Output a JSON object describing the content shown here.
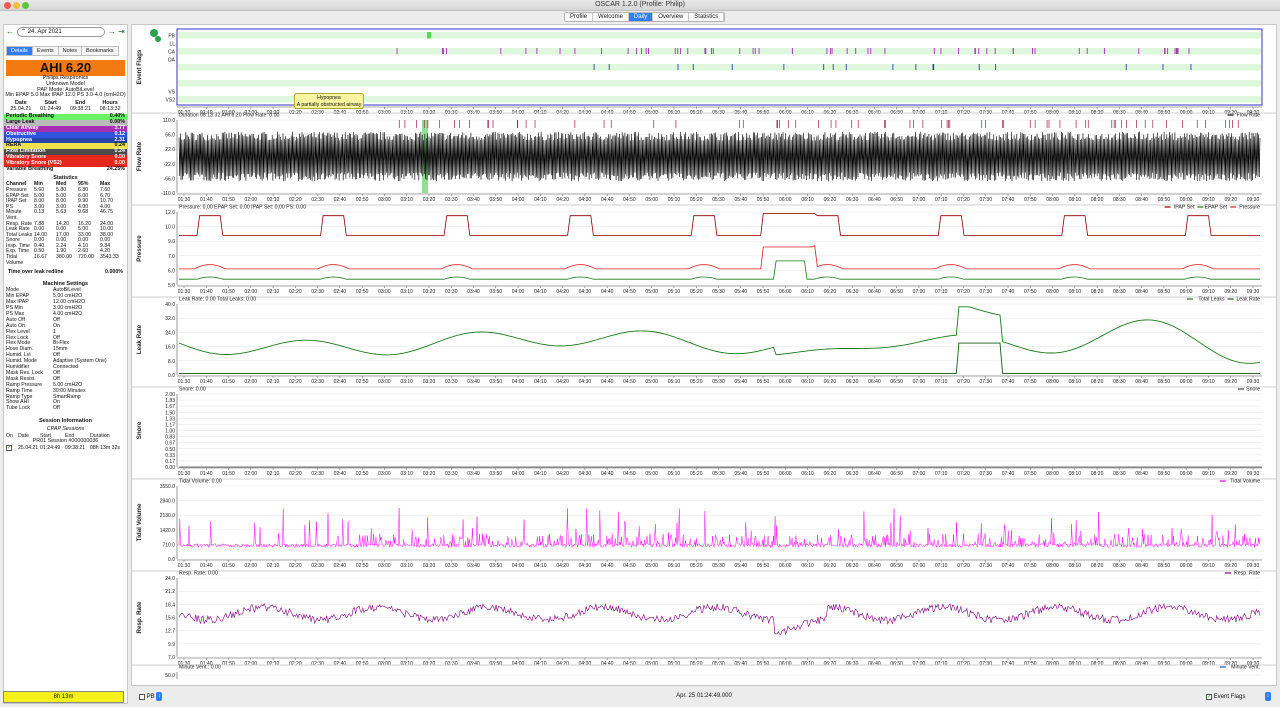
{
  "window": {
    "title": "OSCAR 1.2.0 (Profile: Philip)"
  },
  "tabs": [
    "Profile",
    "Welcome",
    "Daily",
    "Overview",
    "Statistics"
  ],
  "active_tab": "Daily",
  "date": {
    "value": "24. Apr 2021"
  },
  "left_tabs": [
    "Details",
    "Events",
    "Notes",
    "Bookmarks"
  ],
  "summary": {
    "ahi": "AHI 6.20",
    "manufacturer": "Philips Respironics",
    "model": "Unknown Model",
    "mode": "PAP Mode: AutoBiLevel",
    "settings": "Min EPAP 5.0 Max IPAP 12.0 PS 3.0-4.0 (cmH2O)",
    "session_headers": [
      "Date",
      "Start",
      "End",
      "Hours"
    ],
    "session_values": [
      "25.04.21",
      "01:24:49",
      "09:38:21",
      "08:13:32"
    ]
  },
  "events": [
    {
      "label": "Periodic Breathing",
      "value": "0.40%",
      "color": "#6cf266"
    },
    {
      "label": "Large Leak",
      "value": "0.00%",
      "color": "#bbbbbb"
    },
    {
      "label": "Clear Airway",
      "value": "3.77",
      "color": "#a62fb4"
    },
    {
      "label": "Obstructive",
      "value": "0.12",
      "color": "#2f55dc"
    },
    {
      "label": "Hypopnea",
      "value": "2.31",
      "color": "#2545a8"
    },
    {
      "label": "RERA",
      "value": "0.24",
      "color": "#ece44a"
    },
    {
      "label": "Flow Limitation",
      "value": "0.24",
      "color": "#4b4b4b"
    },
    {
      "label": "Vibratory Snore",
      "value": "0.00",
      "color": "#e6271e"
    },
    {
      "label": "Vibratory Snore (VS2)",
      "value": "0.00",
      "color": "#e6271e"
    },
    {
      "label": "Variable Breathing",
      "value": "24.25%",
      "color": "#ffffff"
    }
  ],
  "statistics": {
    "title": "Statistics",
    "headers": [
      "Channel",
      "Min",
      "Med",
      "95%",
      "Max"
    ],
    "rows": [
      [
        "Pressure",
        "5.60",
        "5.80",
        "6.80",
        "7.60"
      ],
      [
        "EPAP Set",
        "5.00",
        "5.00",
        "6.00",
        "6.70"
      ],
      [
        "IPAP Set",
        "8.00",
        "8.00",
        "9.90",
        "10.70"
      ],
      [
        "PS",
        "3.00",
        "3.00",
        "4.00",
        "4.00"
      ],
      [
        "Minute Vent.",
        "0.13",
        "5.63",
        "9.68",
        "46.75"
      ],
      [
        "Resp. Rate",
        "7.88",
        "14.20",
        "16.20",
        "24.00"
      ],
      [
        "Leak Rate",
        "0.00",
        "0.00",
        "5.00",
        "10.00"
      ],
      [
        "Total Leaks",
        "14.00",
        "17.00",
        "33.00",
        "38.00"
      ],
      [
        "Snore",
        "0.00",
        "0.00",
        "0.00",
        "0.00"
      ],
      [
        "Insp. Time",
        "0.40",
        "2.24",
        "4.10",
        "9.34"
      ],
      [
        "Exp. Time",
        "0.50",
        "1.90",
        "2.60",
        "4.20"
      ],
      [
        "Tidal Volume",
        "16.67",
        "380.00",
        "720.00",
        "3543.33"
      ]
    ],
    "leak_redline_label": "Time over leak redline",
    "leak_redline_value": "0.000%"
  },
  "machine_settings": {
    "title": "Machine Settings",
    "rows": [
      [
        "Mode",
        "AutoBiLevel"
      ],
      [
        "Min EPAP",
        "5.00 cmH2O"
      ],
      [
        "Max IPAP",
        "12.00 cmH2O"
      ],
      [
        "PS Min",
        "3.00 cmH2O"
      ],
      [
        "PS Max",
        "4.00 cmH2O"
      ],
      [
        "Auto Off",
        "Off"
      ],
      [
        "Auto On",
        "On"
      ],
      [
        "Flex Level",
        "1"
      ],
      [
        "Flex Lock",
        "Off"
      ],
      [
        "Flex Mode",
        "Bi-Flex"
      ],
      [
        "Hose Diam.",
        "15mm"
      ],
      [
        "Humid. Lvl",
        "Off"
      ],
      [
        "Humid. Mode",
        "Adaptive (System One)"
      ],
      [
        "Humidifier",
        "Connected"
      ],
      [
        "Mask Res. Lock",
        "Off"
      ],
      [
        "Mask Resist.",
        "Off"
      ],
      [
        "Ramp Pressure",
        "5.00 cmH2O"
      ],
      [
        "Ramp Time",
        "30:00 Minutes"
      ],
      [
        "Ramp Type",
        "SmartRamp"
      ],
      [
        "Show AHI",
        "On"
      ],
      [
        "Tube Lock",
        "Off"
      ]
    ]
  },
  "session_info": {
    "title": "Session Information",
    "subtitle": "CPAP Sessions",
    "headers": [
      "On",
      "Date",
      "Start",
      "End",
      "Duration"
    ],
    "device": "PR01 Session #000000036",
    "row": [
      "25.04.21",
      "01:24:49",
      "09:38:21",
      "08h 13m 32s"
    ]
  },
  "total_hours": "8h 13m",
  "tooltip": {
    "title": "Hypopnea",
    "text": "A partially obstructed airway"
  },
  "time_ticks": [
    "01:30",
    "01:40",
    "01:50",
    "02:00",
    "02:10",
    "02:20",
    "02:30",
    "02:40",
    "02:50",
    "03:00",
    "03:10",
    "03:20",
    "03:30",
    "03:40",
    "03:50",
    "04:00",
    "04:10",
    "04:20",
    "04:30",
    "04:40",
    "04:50",
    "05:00",
    "05:10",
    "05:20",
    "05:30",
    "05:40",
    "05:50",
    "06:00",
    "06:10",
    "06:20",
    "06:30",
    "06:40",
    "06:50",
    "07:00",
    "07:10",
    "07:20",
    "07:30",
    "07:40",
    "07:50",
    "08:00",
    "08:10",
    "08:20",
    "08:30",
    "08:40",
    "08:50",
    "09:00",
    "09:10",
    "09:20",
    "09:30"
  ],
  "event_flags": {
    "ylabel": "Event Flags",
    "rows": [
      "PB",
      "LL",
      "CA",
      "OA",
      "",
      "",
      "",
      "VS",
      "VS2"
    ]
  },
  "charts": [
    {
      "name": "flow-rate",
      "ylabel": "Flow Rate",
      "header": "Duration 08:13:32 AHI 6.20 Flow Rate: 0.00",
      "legend": [
        "Flow Rate"
      ],
      "legend_colors": [
        "#000000"
      ],
      "yticks": [
        "110.0",
        "66.0",
        "22.0",
        "-22.0",
        "-66.0",
        "-110.0"
      ]
    },
    {
      "name": "pressure",
      "ylabel": "Pressure",
      "header": "Pressure: 0.00 EPAP Set: 0.00 IPAP Set: 0.00 PS: 0.00",
      "legend": [
        "IPAP Set",
        "EPAP Set",
        "Pressure"
      ],
      "legend_colors": [
        "#8b0000",
        "#1f7a1f",
        "#e02020"
      ],
      "yticks": [
        "12.0",
        "10.0",
        "9.0",
        "7.0",
        "6.0",
        "5.0"
      ]
    },
    {
      "name": "leak-rate",
      "ylabel": "Leak Rate",
      "header": "Leak Rate: 0.00 Total Leaks: 0.00",
      "legend": [
        "Total Leaks",
        "Leak Rate"
      ],
      "legend_colors": [
        "#1a7a1a",
        "#1a5a1a"
      ],
      "yticks": [
        "40.0",
        "32.0",
        "24.0",
        "16.0",
        "8.0",
        "0.0"
      ]
    },
    {
      "name": "snore",
      "ylabel": "Snore",
      "header": "Snore: 0.00",
      "legend": [
        "Snore"
      ],
      "legend_colors": [
        "#444444"
      ],
      "yticks": [
        "2.00",
        "1.83",
        "1.67",
        "1.50",
        "1.33",
        "1.17",
        "1.00",
        "0.83",
        "0.67",
        "0.50",
        "0.33",
        "0.17",
        "0.00"
      ]
    },
    {
      "name": "tidal-volume",
      "ylabel": "Tidal Volume",
      "header": "Tidal Volume: 0.00",
      "legend": [
        "Tidal Volume"
      ],
      "legend_colors": [
        "#ff00ff"
      ],
      "yticks": [
        "3550.0",
        "2840.0",
        "2130.0",
        "1420.0",
        "710.0",
        "0.0"
      ]
    },
    {
      "name": "resp-rate",
      "ylabel": "Resp. Rate",
      "header": "Resp. Rate: 0.00",
      "legend": [
        "Resp. Rate"
      ],
      "legend_colors": [
        "#800080"
      ],
      "yticks": [
        "24.0",
        "21.2",
        "18.4",
        "15.6",
        "12.7",
        "9.9",
        "7.0"
      ]
    },
    {
      "name": "minute-vent",
      "ylabel": "",
      "header": "Minute Vent.: 0.00",
      "legend": [
        "Minute Vent."
      ],
      "legend_colors": [
        "#2050c0"
      ],
      "yticks": [
        "50.0"
      ]
    }
  ],
  "bottom": {
    "left_select": "PB",
    "center": "Apr. 25 01:24:49.000",
    "right_select": "Event Flags"
  }
}
